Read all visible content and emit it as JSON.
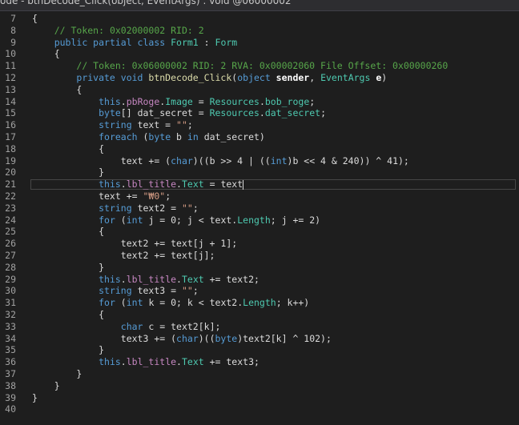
{
  "window": {
    "title": "ode - btnDecode_Click(object, EventArgs) : void @06000002"
  },
  "editor": {
    "current_line": 21,
    "lines": [
      {
        "n": "7",
        "tokens": [
          {
            "t": "{",
            "c": "pl"
          }
        ]
      },
      {
        "n": "8",
        "tokens": [
          {
            "t": "    "
          },
          {
            "t": "// Token: 0x02000002 RID: 2",
            "c": "cm"
          }
        ]
      },
      {
        "n": "9",
        "tokens": [
          {
            "t": "    "
          },
          {
            "t": "public partial class ",
            "c": "kw"
          },
          {
            "t": "Form1",
            "c": "ty"
          },
          {
            "t": " : ",
            "c": "pl"
          },
          {
            "t": "Form",
            "c": "ty"
          }
        ]
      },
      {
        "n": "10",
        "tokens": [
          {
            "t": "    {",
            "c": "pl"
          }
        ]
      },
      {
        "n": "11",
        "tokens": [
          {
            "t": "        "
          },
          {
            "t": "// Token: 0x06000002 RID: 2 RVA: 0x00002060 File Offset: 0x00000260",
            "c": "cm"
          }
        ]
      },
      {
        "n": "12",
        "tokens": [
          {
            "t": "        "
          },
          {
            "t": "private void ",
            "c": "kw"
          },
          {
            "t": "btnDecode_Click",
            "c": "mth"
          },
          {
            "t": "(",
            "c": "pl"
          },
          {
            "t": "object ",
            "c": "kw"
          },
          {
            "t": "sender",
            "c": "prm"
          },
          {
            "t": ", ",
            "c": "pl"
          },
          {
            "t": "EventArgs ",
            "c": "ty"
          },
          {
            "t": "e",
            "c": "prm"
          },
          {
            "t": ")",
            "c": "pl"
          }
        ]
      },
      {
        "n": "13",
        "tokens": [
          {
            "t": "        {",
            "c": "pl"
          }
        ]
      },
      {
        "n": "14",
        "tokens": [
          {
            "t": "            "
          },
          {
            "t": "this",
            "c": "kw"
          },
          {
            "t": ".",
            "c": "pl"
          },
          {
            "t": "pbRoge",
            "c": "fld"
          },
          {
            "t": ".",
            "c": "pl"
          },
          {
            "t": "Image",
            "c": "prop"
          },
          {
            "t": " = ",
            "c": "pl"
          },
          {
            "t": "Resources",
            "c": "ty"
          },
          {
            "t": ".",
            "c": "pl"
          },
          {
            "t": "bob_roge",
            "c": "prop"
          },
          {
            "t": ";",
            "c": "pl"
          }
        ]
      },
      {
        "n": "15",
        "tokens": [
          {
            "t": "            "
          },
          {
            "t": "byte",
            "c": "kw"
          },
          {
            "t": "[] dat_secret = ",
            "c": "pl"
          },
          {
            "t": "Resources",
            "c": "ty"
          },
          {
            "t": ".",
            "c": "pl"
          },
          {
            "t": "dat_secret",
            "c": "prop"
          },
          {
            "t": ";",
            "c": "pl"
          }
        ]
      },
      {
        "n": "16",
        "tokens": [
          {
            "t": "            "
          },
          {
            "t": "string ",
            "c": "kw"
          },
          {
            "t": "text = ",
            "c": "pl"
          },
          {
            "t": "\"\"",
            "c": "str"
          },
          {
            "t": ";",
            "c": "pl"
          }
        ]
      },
      {
        "n": "17",
        "tokens": [
          {
            "t": "            "
          },
          {
            "t": "foreach ",
            "c": "kw"
          },
          {
            "t": "(",
            "c": "pl"
          },
          {
            "t": "byte ",
            "c": "kw"
          },
          {
            "t": "b ",
            "c": "pl"
          },
          {
            "t": "in ",
            "c": "kw"
          },
          {
            "t": "dat_secret)",
            "c": "pl"
          }
        ]
      },
      {
        "n": "18",
        "tokens": [
          {
            "t": "            {",
            "c": "pl"
          }
        ]
      },
      {
        "n": "19",
        "tokens": [
          {
            "t": "                text += (",
            "c": "pl"
          },
          {
            "t": "char",
            "c": "kw"
          },
          {
            "t": ")((b >> 4 | ((",
            "c": "pl"
          },
          {
            "t": "int",
            "c": "kw"
          },
          {
            "t": ")b << 4 & 240)) ^ 41);",
            "c": "pl"
          }
        ]
      },
      {
        "n": "20",
        "tokens": [
          {
            "t": "            }",
            "c": "pl"
          }
        ]
      },
      {
        "n": "21",
        "tokens": [
          {
            "t": "            "
          },
          {
            "t": "this",
            "c": "kw"
          },
          {
            "t": ".",
            "c": "pl"
          },
          {
            "t": "lbl_title",
            "c": "fld"
          },
          {
            "t": ".",
            "c": "pl"
          },
          {
            "t": "Text",
            "c": "prop"
          },
          {
            "t": " = text",
            "c": "pl"
          },
          {
            "t": "|",
            "c": "caret"
          }
        ]
      },
      {
        "n": "22",
        "tokens": [
          {
            "t": "            text += ",
            "c": "pl"
          },
          {
            "t": "\"₩0\"",
            "c": "str"
          },
          {
            "t": ";",
            "c": "pl"
          }
        ]
      },
      {
        "n": "23",
        "tokens": [
          {
            "t": "            "
          },
          {
            "t": "string ",
            "c": "kw"
          },
          {
            "t": "text2 = ",
            "c": "pl"
          },
          {
            "t": "\"\"",
            "c": "str"
          },
          {
            "t": ";",
            "c": "pl"
          }
        ]
      },
      {
        "n": "24",
        "tokens": [
          {
            "t": "            "
          },
          {
            "t": "for ",
            "c": "kw"
          },
          {
            "t": "(",
            "c": "pl"
          },
          {
            "t": "int ",
            "c": "kw"
          },
          {
            "t": "j = 0; j < text.",
            "c": "pl"
          },
          {
            "t": "Length",
            "c": "prop"
          },
          {
            "t": "; j += 2)",
            "c": "pl"
          }
        ]
      },
      {
        "n": "25",
        "tokens": [
          {
            "t": "            {",
            "c": "pl"
          }
        ]
      },
      {
        "n": "26",
        "tokens": [
          {
            "t": "                text2 += text[j + 1];",
            "c": "pl"
          }
        ]
      },
      {
        "n": "27",
        "tokens": [
          {
            "t": "                text2 += text[j];",
            "c": "pl"
          }
        ]
      },
      {
        "n": "28",
        "tokens": [
          {
            "t": "            }",
            "c": "pl"
          }
        ]
      },
      {
        "n": "29",
        "tokens": [
          {
            "t": "            "
          },
          {
            "t": "this",
            "c": "kw"
          },
          {
            "t": ".",
            "c": "pl"
          },
          {
            "t": "lbl_title",
            "c": "fld"
          },
          {
            "t": ".",
            "c": "pl"
          },
          {
            "t": "Text",
            "c": "prop"
          },
          {
            "t": " += text2;",
            "c": "pl"
          }
        ]
      },
      {
        "n": "30",
        "tokens": [
          {
            "t": "            "
          },
          {
            "t": "string ",
            "c": "kw"
          },
          {
            "t": "text3 = ",
            "c": "pl"
          },
          {
            "t": "\"\"",
            "c": "str"
          },
          {
            "t": ";",
            "c": "pl"
          }
        ]
      },
      {
        "n": "31",
        "tokens": [
          {
            "t": "            "
          },
          {
            "t": "for ",
            "c": "kw"
          },
          {
            "t": "(",
            "c": "pl"
          },
          {
            "t": "int ",
            "c": "kw"
          },
          {
            "t": "k = 0; k < text2.",
            "c": "pl"
          },
          {
            "t": "Length",
            "c": "prop"
          },
          {
            "t": "; k++)",
            "c": "pl"
          }
        ]
      },
      {
        "n": "32",
        "tokens": [
          {
            "t": "            {",
            "c": "pl"
          }
        ]
      },
      {
        "n": "33",
        "tokens": [
          {
            "t": "                "
          },
          {
            "t": "char ",
            "c": "kw"
          },
          {
            "t": "c = text2[k];",
            "c": "pl"
          }
        ]
      },
      {
        "n": "34",
        "tokens": [
          {
            "t": "                text3 += (",
            "c": "pl"
          },
          {
            "t": "char",
            "c": "kw"
          },
          {
            "t": ")((",
            "c": "pl"
          },
          {
            "t": "byte",
            "c": "kw"
          },
          {
            "t": ")text2[k] ^ 102);",
            "c": "pl"
          }
        ]
      },
      {
        "n": "35",
        "tokens": [
          {
            "t": "            }",
            "c": "pl"
          }
        ]
      },
      {
        "n": "36",
        "tokens": [
          {
            "t": "            "
          },
          {
            "t": "this",
            "c": "kw"
          },
          {
            "t": ".",
            "c": "pl"
          },
          {
            "t": "lbl_title",
            "c": "fld"
          },
          {
            "t": ".",
            "c": "pl"
          },
          {
            "t": "Text",
            "c": "prop"
          },
          {
            "t": " += text3;",
            "c": "pl"
          }
        ]
      },
      {
        "n": "37",
        "tokens": [
          {
            "t": "        }",
            "c": "pl"
          }
        ]
      },
      {
        "n": "38",
        "tokens": [
          {
            "t": "    }",
            "c": "pl"
          }
        ]
      },
      {
        "n": "39",
        "tokens": [
          {
            "t": "}",
            "c": "pl"
          }
        ]
      },
      {
        "n": "40",
        "tokens": []
      }
    ]
  }
}
